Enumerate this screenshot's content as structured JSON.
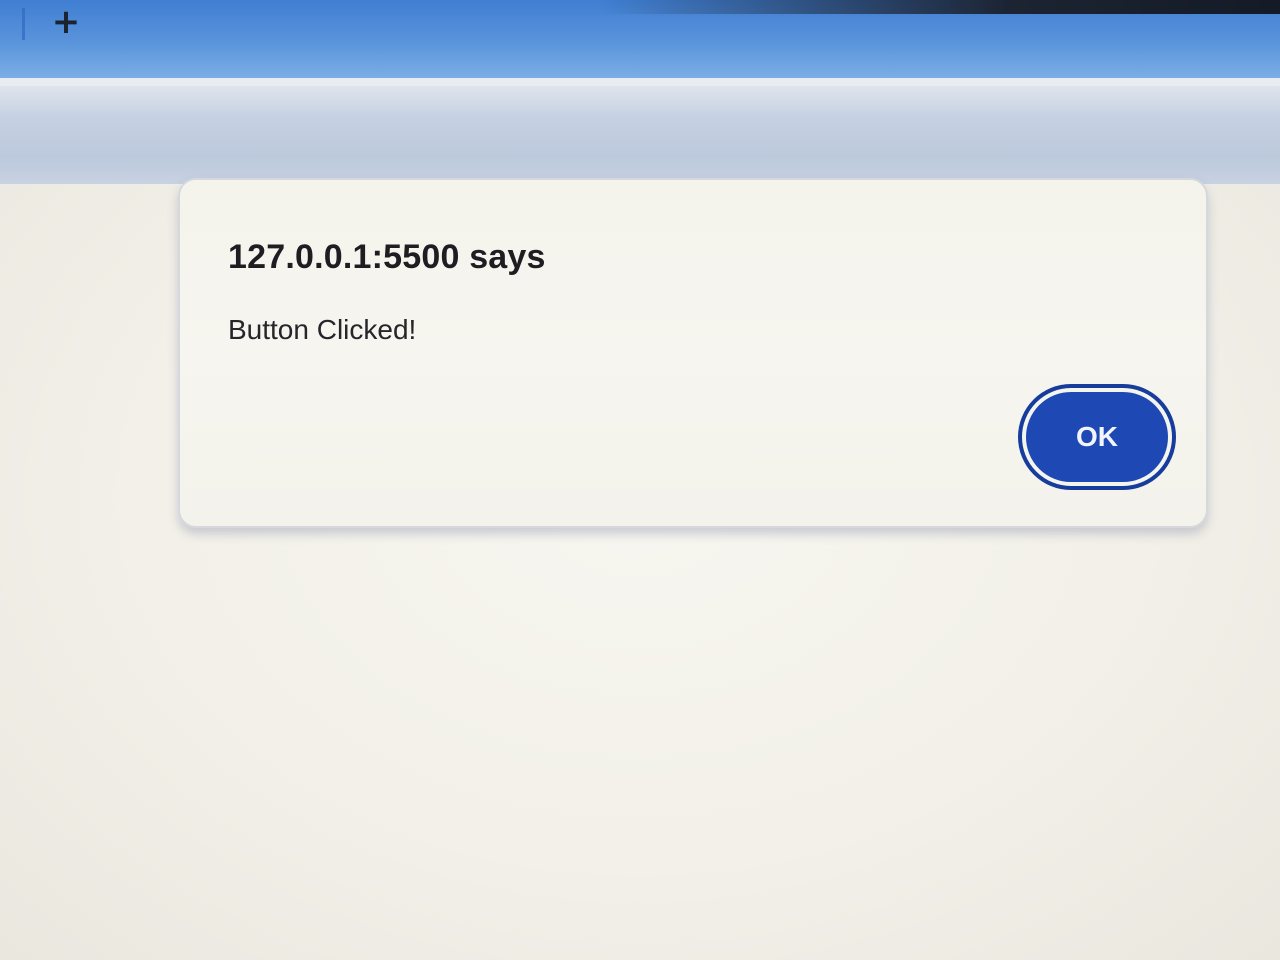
{
  "browser": {
    "new_tab_symbol": "+",
    "new_tab_icon": "plus-icon"
  },
  "alert": {
    "title": "127.0.0.1:5500 says",
    "message": "Button Clicked!",
    "ok_label": "OK"
  },
  "colors": {
    "tab_strip": "#4f8ad8",
    "ok_button": "#1e48b3",
    "dialog_background": "#f5f4ee"
  }
}
